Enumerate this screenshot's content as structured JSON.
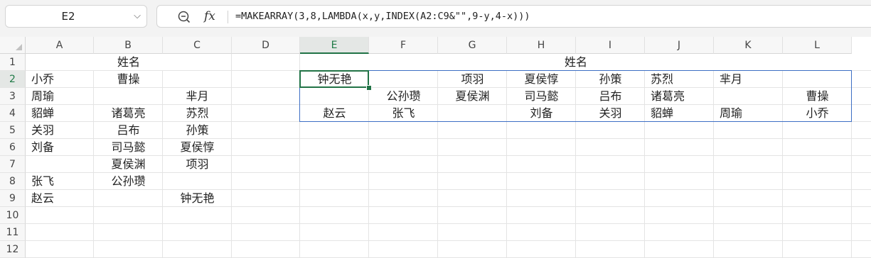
{
  "name_box": {
    "value": "E2"
  },
  "formula_bar": {
    "formula": "=MAKEARRAY(3,8,LAMBDA(x,y,INDEX(A2:C9&\"\",9-y,4-x)))"
  },
  "columns": [
    "A",
    "B",
    "C",
    "D",
    "E",
    "F",
    "G",
    "H",
    "I",
    "J",
    "K",
    "L"
  ],
  "rows": [
    "1",
    "2",
    "3",
    "4",
    "5",
    "6",
    "7",
    "8",
    "9",
    "10",
    "11",
    "12"
  ],
  "active": {
    "column": "E",
    "row": "2"
  },
  "source_header": "姓名",
  "result_header": "姓名",
  "source_rows": [
    [
      "小乔",
      "曹操",
      ""
    ],
    [
      "周瑜",
      "",
      "芈月"
    ],
    [
      "貂蝉",
      "诸葛亮",
      "苏烈"
    ],
    [
      "关羽",
      "吕布",
      "孙策"
    ],
    [
      "刘备",
      "司马懿",
      "夏侯惇"
    ],
    [
      "",
      "夏侯渊",
      "项羽"
    ],
    [
      "张飞",
      "公孙瓒",
      ""
    ],
    [
      "赵云",
      "",
      "钟无艳"
    ]
  ],
  "result_rows": [
    [
      "钟无艳",
      "",
      "项羽",
      "夏侯惇",
      "孙策",
      "苏烈",
      "芈月",
      ""
    ],
    [
      "",
      "公孙瓒",
      "夏侯渊",
      "司马懿",
      "吕布",
      "诸葛亮",
      "",
      "曹操"
    ],
    [
      "赵云",
      "张飞",
      "",
      "刘备",
      "关羽",
      "貂蝉",
      "周瑜",
      "小乔"
    ]
  ],
  "icons": {
    "name_box_dropdown": "chevron-down-icon",
    "zoom": "zoom-out-icon",
    "function": "fx-icon"
  },
  "colors": {
    "active_green": "#217346",
    "spill_border": "#3d6fc4"
  }
}
